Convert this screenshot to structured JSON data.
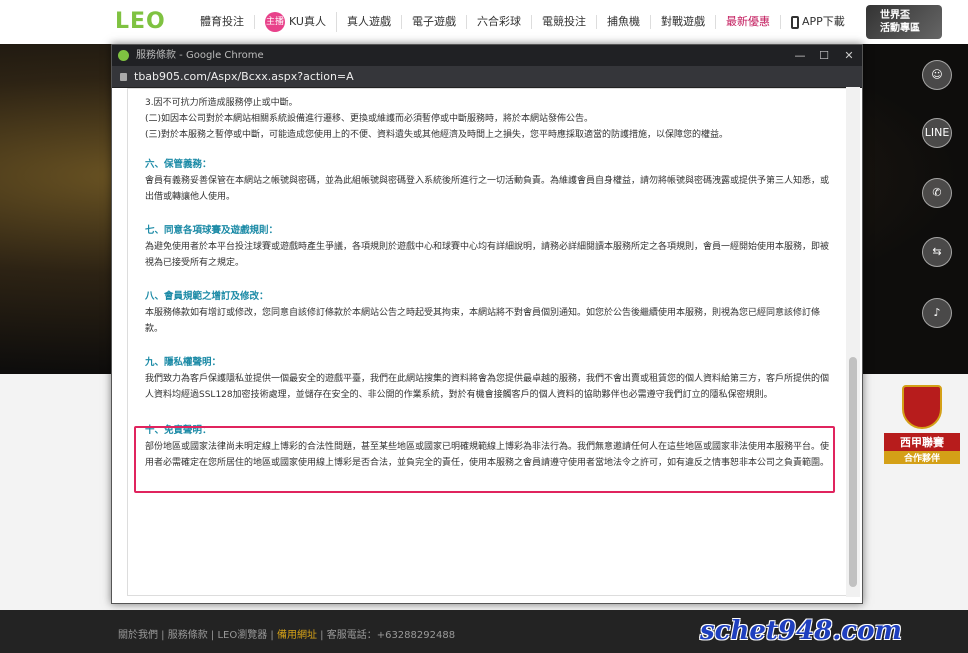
{
  "header": {
    "logo": "LEO",
    "nav": [
      {
        "label": "體育投注"
      },
      {
        "label": "KU真人",
        "badge": "主播"
      },
      {
        "label": "真人遊戲"
      },
      {
        "label": "電子遊戲"
      },
      {
        "label": "六合彩球"
      },
      {
        "label": "電競投注"
      },
      {
        "label": "捕魚機"
      },
      {
        "label": "對戰遊戲"
      },
      {
        "label": "最新優惠"
      },
      {
        "label": "APP下載"
      }
    ],
    "banner": {
      "line1": "世界盃",
      "line2": "活動專區"
    }
  },
  "chrome": {
    "title": "服務條款 - Google Chrome",
    "url": "tbab905.com/Aspx/Bcxx.aspx?action=A",
    "controls": [
      "—",
      "☐",
      "✕"
    ]
  },
  "doc": {
    "intro": [
      "3.因不可抗力所造成服務停止或中斷。",
      "(二)如因本公司對於本網站相關系統設備進行遷移、更換或維護而必須暫停或中斷服務時，將於本網站發佈公告。",
      "(三)對於本服務之暫停或中斷，可能造成您使用上的不便、資料遺失或其他經濟及時間上之損失，您平時應採取適當的防護措施，以保障您的權益。"
    ],
    "sections": [
      {
        "title": "六、保管義務：",
        "body": "會員有義務妥善保管在本網站之帳號與密碼，並為此組帳號與密碼登入系統後所進行之一切活動負責。為維護會員自身權益，請勿將帳號與密碼洩露或提供予第三人知悉，或出借或轉讓他人使用。"
      },
      {
        "title": "七、同意各項球賽及遊戲規則：",
        "body": "為避免使用者於本平台投注球賽或遊戲時產生爭議，各項規則於遊戲中心和球賽中心均有詳細說明，請務必詳細閱讀本服務所定之各項規則，會員一經開始使用本服務，即被視為已接受所有之規定。"
      },
      {
        "title": "八、會員規範之增訂及修改：",
        "body": "本服務條款如有增訂或修改，您同意自該修訂條款於本網站公告之時起受其拘束，本網站將不對會員個別通知。如您於公告後繼續使用本服務，則視為您已經同意該修訂條款。"
      },
      {
        "title": "九、隱私權聲明：",
        "body": "我們致力為客戶保護隱私並提供一個最安全的遊戲平臺，我們在此網站搜集的資料將會為您提供最卓越的服務，我們不會出賣或租賃您的個人資料給第三方，客戶所提供的個人資料均經過SSL128加密技術處理，並儲存在安全的、非公開的作業系統，對於有機會接觸客戶的個人資料的協助夥伴也必需遵守我們訂立的隱私保密規則。"
      },
      {
        "title": "十、免責聲明：",
        "body": "部份地區或國家法律尚未明定線上博彩的合法性問題，甚至某些地區或國家已明確規範線上博彩為非法行為。我們無意邀請任何人在這些地區或國家非法使用本服務平台。使用者必需確定在您所居住的地區或國家使用線上博彩是否合法，並負完全的責任，使用本服務之會員請遵守使用者當地法令之許可，如有違反之情事恕非本公司之負責範圍。"
      }
    ]
  },
  "side": {
    "buttons": [
      "LINE"
    ],
    "partner": {
      "line1": "西甲聯賽",
      "line2": "合作夥伴"
    }
  },
  "footer": {
    "links": [
      "關於我們",
      "服務條款",
      "LEO瀏覽器",
      "備用網址"
    ],
    "phone": "客服電話：+63288292488",
    "watermark": "schet948.com"
  }
}
